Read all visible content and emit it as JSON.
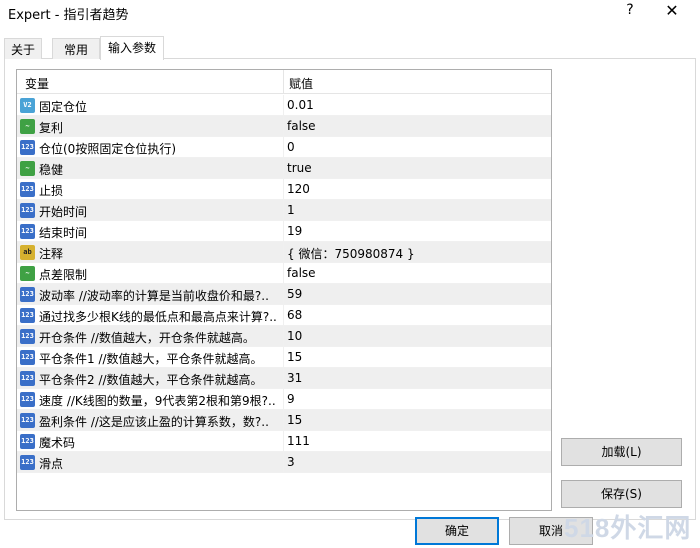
{
  "window": {
    "title": "Expert - 指引者趋势",
    "help": "?",
    "close": "✕"
  },
  "tabs": [
    {
      "label": "关于"
    },
    {
      "label": "常用"
    },
    {
      "label": "输入参数"
    }
  ],
  "table": {
    "headers": {
      "variable": "变量",
      "value": "赋值"
    },
    "rows": [
      {
        "icon": "dbl",
        "icon_text": "V2",
        "name": "固定仓位",
        "value": "0.01"
      },
      {
        "icon": "bool",
        "icon_text": "~",
        "name": "复利",
        "value": "false"
      },
      {
        "icon": "num",
        "icon_text": "123",
        "name": "仓位(0按照固定仓位执行)",
        "value": "0"
      },
      {
        "icon": "bool",
        "icon_text": "~",
        "name": "稳健",
        "value": "true"
      },
      {
        "icon": "num",
        "icon_text": "123",
        "name": "止损",
        "value": "120"
      },
      {
        "icon": "num",
        "icon_text": "123",
        "name": "开始时间",
        "value": "1"
      },
      {
        "icon": "num",
        "icon_text": "123",
        "name": "结束时间",
        "value": "19"
      },
      {
        "icon": "str",
        "icon_text": "ab",
        "name": "注释",
        "value": "{ 微信：750980874 }"
      },
      {
        "icon": "bool",
        "icon_text": "~",
        "name": "点差限制",
        "value": "false"
      },
      {
        "icon": "num",
        "icon_text": "123",
        "name": "波动率  //波动率的计算是当前收盘价和最?..",
        "value": "59"
      },
      {
        "icon": "num",
        "icon_text": "123",
        "name": "通过找多少根K线的最低点和最高点来计算?..",
        "value": "68"
      },
      {
        "icon": "num",
        "icon_text": "123",
        "name": "开仓条件  //数值越大，开仓条件就越高。",
        "value": "10"
      },
      {
        "icon": "num",
        "icon_text": "123",
        "name": "平仓条件1  //数值越大，平仓条件就越高。",
        "value": "15"
      },
      {
        "icon": "num",
        "icon_text": "123",
        "name": "平仓条件2  //数值越大，平仓条件就越高。",
        "value": "31"
      },
      {
        "icon": "num",
        "icon_text": "123",
        "name": "速度  //K线图的数量，9代表第2根和第9根?..",
        "value": "9"
      },
      {
        "icon": "num",
        "icon_text": "123",
        "name": "盈利条件  //这是应该止盈的计算系数，数?..",
        "value": "15"
      },
      {
        "icon": "num",
        "icon_text": "123",
        "name": "魔术码",
        "value": "111"
      },
      {
        "icon": "num",
        "icon_text": "123",
        "name": "滑点",
        "value": "3"
      }
    ]
  },
  "buttons": {
    "load": "加载(L)",
    "save": "保存(S)",
    "ok": "确定",
    "cancel": "取消"
  },
  "watermark": "518外汇网"
}
